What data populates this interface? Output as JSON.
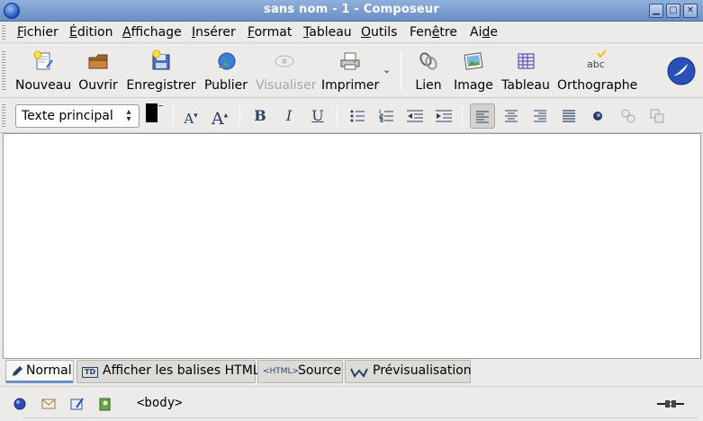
{
  "window": {
    "title": "sans nom - 1 - Composeur",
    "controls": [
      "minimize-icon",
      "maximize-icon",
      "close-icon"
    ]
  },
  "menu": [
    "Fichier",
    "Édition",
    "Affichage",
    "Insérer",
    "Format",
    "Tableau",
    "Outils",
    "Fenêtre",
    "Aide"
  ],
  "toolbar": {
    "nouveau": "Nouveau",
    "ouvrir": "Ouvrir",
    "enregistrer": "Enregistrer",
    "publier": "Publier",
    "visualiser": "Visualiser",
    "imprimer": "Imprimer",
    "lien": "Lien",
    "image": "Image",
    "tableau": "Tableau",
    "orthographe": "Orthographe"
  },
  "format": {
    "paragraph_style": "Texte principal",
    "text_color": "#000000",
    "buttons": [
      "font-size-down-icon",
      "font-size-up-icon",
      "bold-icon",
      "italic-icon",
      "underline-icon",
      "bullet-list-icon",
      "numbered-list-icon",
      "outdent-icon",
      "indent-icon",
      "align-left-icon",
      "align-center-icon",
      "align-right-icon",
      "justify-icon",
      "insert-anchor-icon",
      "image-position-icon",
      "image-layer-icon"
    ]
  },
  "tabs": {
    "normal": "Normal",
    "balises": "Afficher les balises HTML",
    "source": "Source",
    "preview": "Prévisualisation",
    "source_icon_text": "<HTML>",
    "td_icon_text": "TD"
  },
  "status": {
    "tag": "<body>"
  }
}
